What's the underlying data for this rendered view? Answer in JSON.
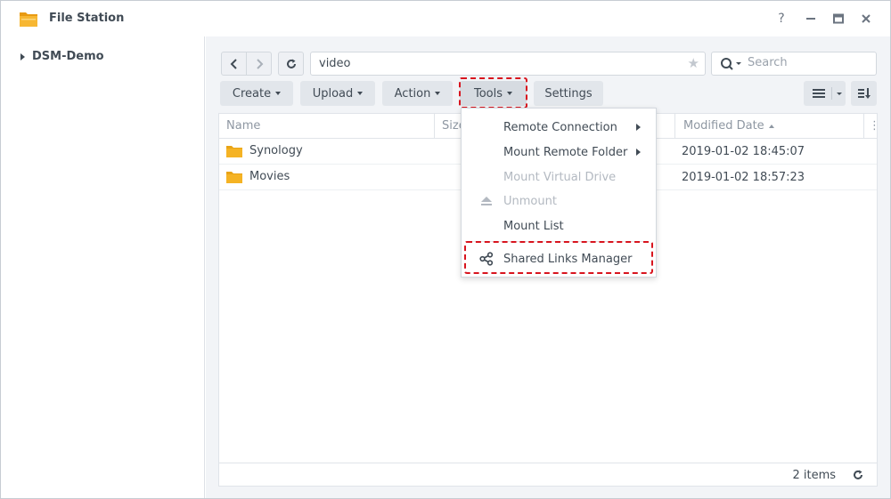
{
  "window": {
    "title": "File Station"
  },
  "sidebar": {
    "root_label": "DSM-Demo"
  },
  "path": {
    "value": "video"
  },
  "search": {
    "placeholder": "Search"
  },
  "toolbar": {
    "create_label": "Create",
    "upload_label": "Upload",
    "action_label": "Action",
    "tools_label": "Tools",
    "settings_label": "Settings"
  },
  "columns": {
    "name": "Name",
    "size": "Size",
    "modified": "Modified Date"
  },
  "files": [
    {
      "name": "Synology",
      "modified": "2019-01-02 18:45:07"
    },
    {
      "name": "Movies",
      "modified": "2019-01-02 18:57:23"
    }
  ],
  "status": {
    "count": "2 items"
  },
  "tools_menu": {
    "remote_connection": "Remote Connection",
    "mount_remote_folder": "Mount Remote Folder",
    "mount_virtual_drive": "Mount Virtual Drive",
    "unmount": "Unmount",
    "mount_list": "Mount List",
    "shared_links_manager": "Shared Links Manager"
  },
  "colors": {
    "highlight": "#d8141e",
    "folder": "#f5b324"
  }
}
